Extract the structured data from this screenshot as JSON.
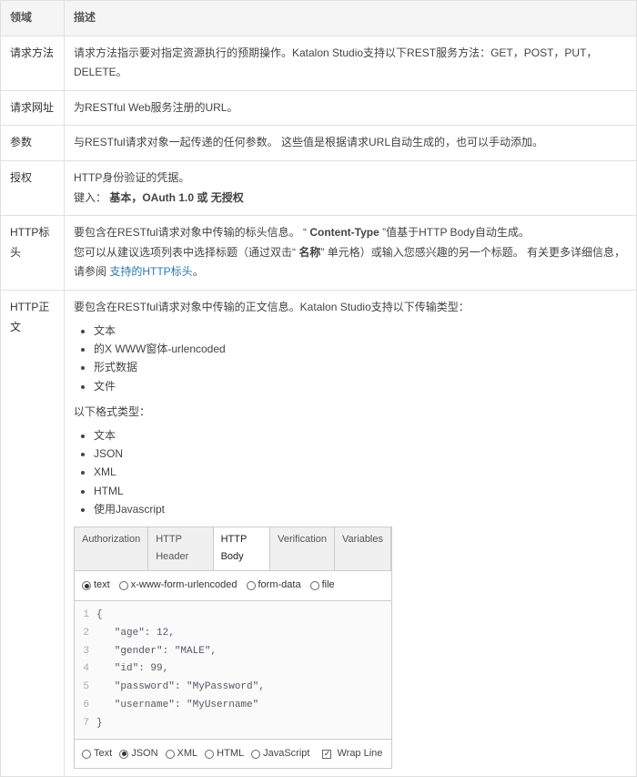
{
  "headers": {
    "field": "领域",
    "desc": "描述"
  },
  "rows": {
    "method": {
      "field": "请求方法",
      "desc_pre": "请求方法指示要对指定资源执行的预期操作。Katalon Studio支持以下REST服务方法：GET，POST，PUT，DELETE。"
    },
    "url": {
      "field": "请求网址",
      "desc": "为RESTful Web服务注册的URL。"
    },
    "params": {
      "field": "参数",
      "desc": "与RESTful请求对象一起传递的任何参数。 这些值是根据请求URL自动生成的，也可以手动添加。"
    },
    "auth": {
      "field": "授权",
      "line1": "HTTP身份验证的凭据。",
      "line2_label": "键入：",
      "line2_opts": " 基本，OAuth 1.0 或 无授权"
    },
    "http_header": {
      "field": "HTTP标头",
      "seg1": "要包含在RESTful请求对象中传输的标头信息。 “ ",
      "ct": "Content-Type",
      "seg2": " ”值基于HTTP Body自动生成。",
      "line2_a": "您可以从建议选项列表中选择标题（通过双击“ ",
      "line2_name": "名称",
      "line2_b": "” 单元格）或输入您感兴趣的另一个标题。 有关更多详细信息，请参阅 ",
      "link": "支持的HTTP标头",
      "line2_c": "。"
    },
    "http_body": {
      "field": "HTTP正文",
      "intro": "要包含在RESTful请求对象中传输的正文信息。Katalon Studio支持以下传输类型：",
      "types": [
        "文本",
        "的X WWW窗体-urlencoded",
        "形式数据",
        "文件"
      ],
      "fmt_label": "以下格式类型：",
      "formats": [
        "文本",
        "JSON",
        "XML",
        "HTML",
        "使用Javascript"
      ]
    }
  },
  "editor": {
    "tabs": [
      "Authorization",
      "HTTP Header",
      "HTTP Body",
      "Verification",
      "Variables"
    ],
    "active_tab": 2,
    "top_radios": [
      "text",
      "x-www-form-urlencoded",
      "form-data",
      "file"
    ],
    "top_selected": "text",
    "bottom_radios": [
      "Text",
      "JSON",
      "XML",
      "HTML",
      "JavaScript"
    ],
    "bottom_selected": "JSON",
    "wrap_label": "Wrap Line",
    "wrap_checked": true,
    "code": [
      "{",
      "   \"age\": 12,",
      "   \"gender\": \"MALE\",",
      "   \"id\": 99,",
      "   \"password\": \"MyPassword\",",
      "   \"username\": \"MyUsername\"",
      "}"
    ]
  }
}
